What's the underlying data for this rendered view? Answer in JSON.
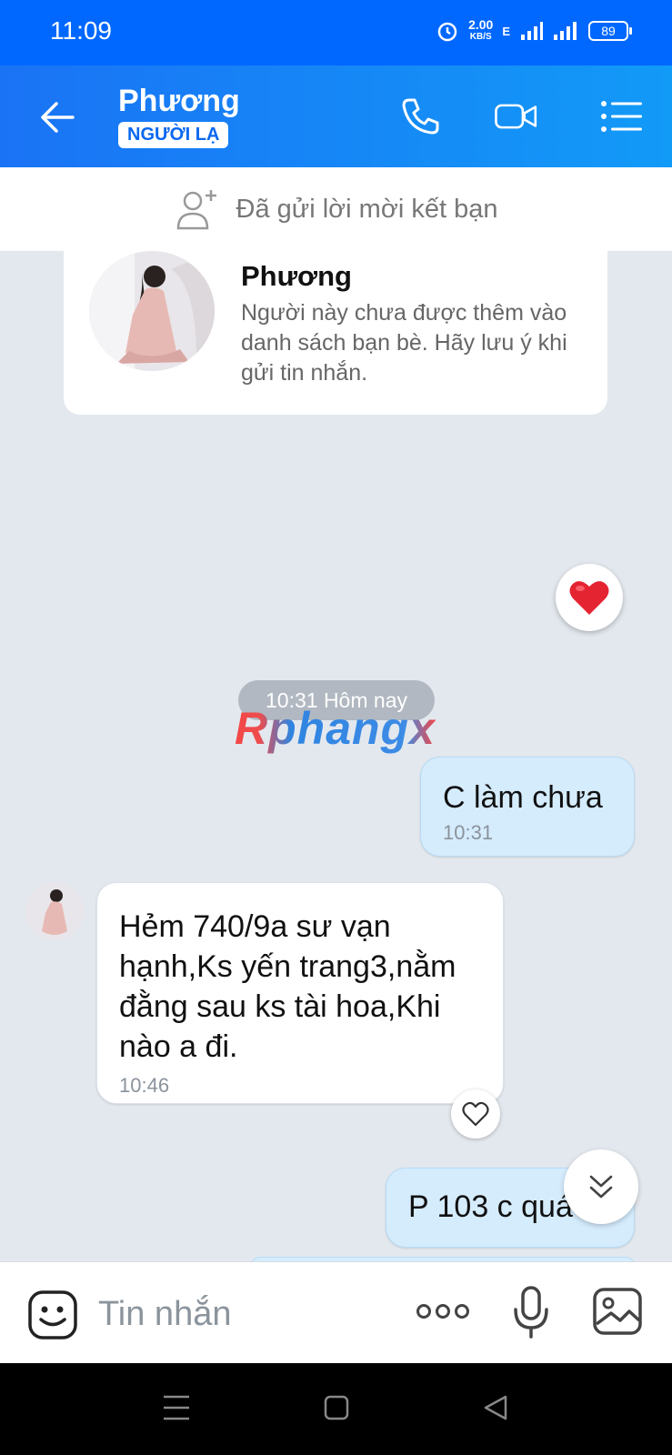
{
  "status_bar": {
    "time": "11:09",
    "net_speed_value": "2.00",
    "net_speed_unit": "KB/S",
    "network_type": "E",
    "battery": "89"
  },
  "header": {
    "contact_name": "Phương",
    "badge": "NGƯỜI LẠ"
  },
  "friend_request": {
    "text": "Đã gửi lời mời kết bạn"
  },
  "profile_card": {
    "name": "Phương",
    "note": "Người này chưa được thêm vào danh sách bạn bè. Hãy lưu ý khi gửi tin nhắn."
  },
  "date_separator": "10:31 Hôm nay",
  "watermark": "Rphangx",
  "messages": [
    {
      "direction": "out",
      "text": "C làm chưa",
      "time": "10:31"
    },
    {
      "direction": "in",
      "text": "Hẻm 740/9a sư vạn hạnh,Ks yến trang3,nằm đằng sau ks tài hoa,Khi nào a đi.",
      "time": "10:46"
    },
    {
      "direction": "out",
      "text": "P 103 c quá",
      "time": ""
    }
  ],
  "composer": {
    "placeholder": "Tin nhắn"
  },
  "colors": {
    "accent": "#0068ff",
    "out_bubble": "#d5ecfd",
    "in_bubble": "#ffffff",
    "chat_bg": "#e3e8ee"
  }
}
